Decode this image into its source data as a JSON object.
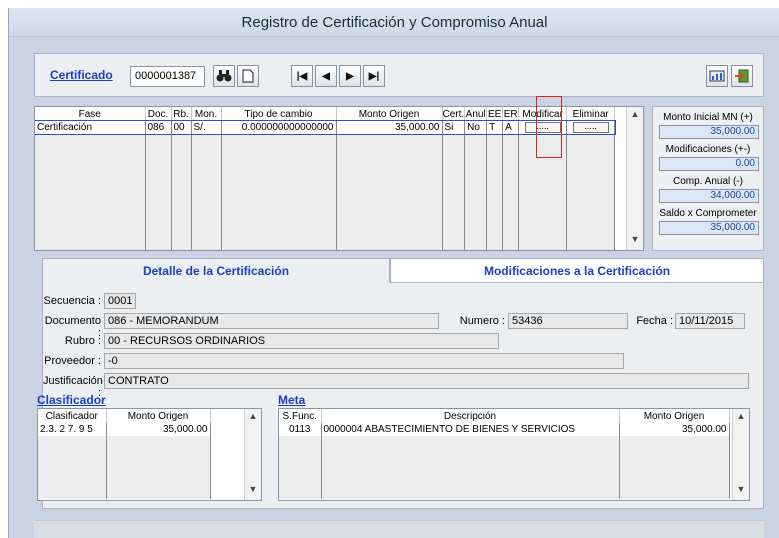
{
  "window": {
    "title": "Registro de Certificación y Compromiso Anual"
  },
  "toolbar": {
    "label": "Certificado",
    "certificate_number": "0000001387",
    "icons": [
      "binoculars-icon",
      "new-document-icon",
      "first-record-icon",
      "prev-record-icon",
      "next-record-icon",
      "last-record-icon",
      "report-icon",
      "exit-icon"
    ]
  },
  "main_grid": {
    "headers": [
      "Fase",
      "Doc.",
      "Rb.",
      "Mon.",
      "Tipo de cambio",
      "Monto Origen",
      "Cert.",
      "Anul",
      "EE",
      "ER",
      "Modificar",
      "Eliminar"
    ],
    "rows": [
      {
        "fase": "Certificación",
        "doc": "086",
        "rb": "00",
        "mon": "S/.",
        "tipo_cambio": "0.000000000000000",
        "monto": "35,000.00",
        "cert": "Si",
        "anul": "No",
        "ee": "T",
        "er": "A",
        "modificar": ".....",
        "eliminar": "....."
      }
    ]
  },
  "summary": {
    "monto_inicial_label": "Monto Inicial MN (+)",
    "monto_inicial_value": "35,000.00",
    "modificaciones_label": "Modificaciones (+-)",
    "modificaciones_value": "0.00",
    "comp_anual_label": "Comp. Anual (-)",
    "comp_anual_value": "34,000.00",
    "saldo_label": "Saldo x Comprometer",
    "saldo_value": "35,000.00"
  },
  "tabs": {
    "detalle": "Detalle de la Certificación",
    "modificaciones": "Modificaciones a la Certificación"
  },
  "detail": {
    "secuencia_label": "Secuencia :",
    "secuencia_value": "0001",
    "documento_label": "Documento :",
    "documento_value": "086 - MEMORANDUM",
    "numero_label": "Numero :",
    "numero_value": "53436",
    "fecha_label": "Fecha :",
    "fecha_value": "10/11/2015",
    "rubro_label": "Rubro :",
    "rubro_value": "00 - RECURSOS ORDINARIOS",
    "proveedor_label": "Proveedor :",
    "proveedor_value": "-0",
    "justificacion_label": "Justificación :",
    "justificacion_value": "CONTRATO"
  },
  "clasificador": {
    "title": "Clasificador",
    "headers": [
      "Clasificador",
      "Monto Origen"
    ],
    "rows": [
      {
        "codigo": "2.3. 2 7. 9 5",
        "monto": "35,000.00"
      }
    ]
  },
  "meta": {
    "title": "Meta",
    "headers": [
      "S.Func.",
      "Descripción",
      "Monto Origen"
    ],
    "rows": [
      {
        "sfunc": "0113",
        "descripcion": "0000004  ABASTECIMIENTO DE BIENES Y SERVICIOS",
        "monto": "35,000.00"
      }
    ]
  },
  "colors": {
    "window_bg": "#c9d3e3",
    "link": "#1a3ec2",
    "highlight_box": "#e5211d",
    "value_bg": "#dde6f6"
  }
}
